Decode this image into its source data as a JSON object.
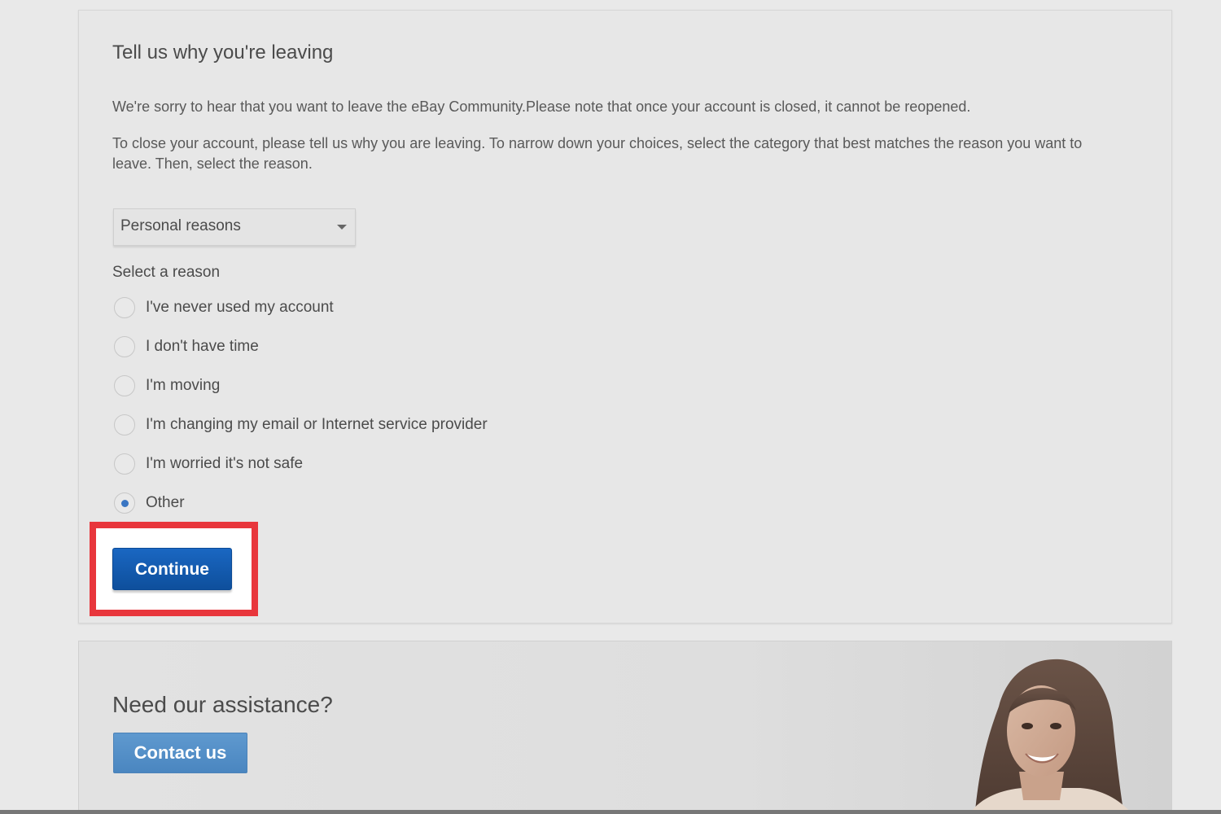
{
  "main": {
    "title": "Tell us why you're leaving",
    "paragraph_1": "We're sorry to hear that you want to leave the eBay Community.Please note that once your account is closed, it cannot be reopened.",
    "paragraph_2": "To close your account, please tell us why you are leaving. To narrow down your choices, select the category that best matches the reason you want to leave. Then, select the reason.",
    "category_select": {
      "value": "Personal reasons"
    },
    "reason_label": "Select a reason",
    "reasons": [
      {
        "label": "I've never used my account",
        "checked": false
      },
      {
        "label": "I don't have time",
        "checked": false
      },
      {
        "label": "I'm moving",
        "checked": false
      },
      {
        "label": "I'm changing my email or Internet service provider",
        "checked": false
      },
      {
        "label": "I'm worried it's not safe",
        "checked": false
      },
      {
        "label": "Other",
        "checked": true
      }
    ],
    "continue_label": "Continue"
  },
  "assistance": {
    "title": "Need our assistance?",
    "contact_label": "Contact us"
  },
  "colors": {
    "highlight": "#e8363c",
    "primary_button": "#0e5fb8",
    "contact_button": "#5591c8",
    "radio_selected": "#3a76c3"
  }
}
